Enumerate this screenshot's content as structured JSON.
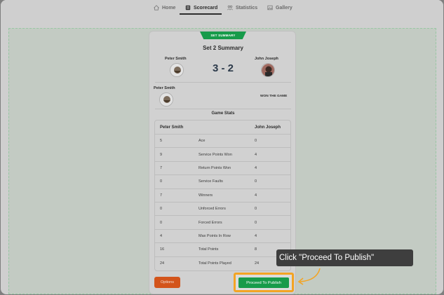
{
  "nav": {
    "items": [
      {
        "label": "Home",
        "icon": "home-icon"
      },
      {
        "label": "Scorecard",
        "icon": "scorecard-icon"
      },
      {
        "label": "Statistics",
        "icon": "statistics-icon"
      },
      {
        "label": "Gallery",
        "icon": "gallery-icon"
      }
    ],
    "active": "Scorecard"
  },
  "card": {
    "ribbon": "SET SUMMARY",
    "title": "Set 2 Summary",
    "player1": "Peter Smith",
    "player2": "John Joseph",
    "score": "3 - 2",
    "winner_name": "Peter Smith",
    "winner_text": "WON THE GAME",
    "stats_title": "Game Stats"
  },
  "table": {
    "header": {
      "left": "Peter Smith",
      "right": "John Joseph"
    },
    "rows": [
      {
        "p1": "5",
        "stat": "Ace",
        "p2": "0"
      },
      {
        "p1": "9",
        "stat": "Service Points Won",
        "p2": "4"
      },
      {
        "p1": "7",
        "stat": "Return Points Won",
        "p2": "4"
      },
      {
        "p1": "0",
        "stat": "Service Faults",
        "p2": "0"
      },
      {
        "p1": "7",
        "stat": "Winners",
        "p2": "4"
      },
      {
        "p1": "0",
        "stat": "Unforced Errors",
        "p2": "0"
      },
      {
        "p1": "0",
        "stat": "Forced Errors",
        "p2": "0"
      },
      {
        "p1": "4",
        "stat": "Max Points In Row",
        "p2": "4"
      },
      {
        "p1": "16",
        "stat": "Total Points",
        "p2": "8"
      },
      {
        "p1": "24",
        "stat": "Total Points Played",
        "p2": "24"
      }
    ]
  },
  "buttons": {
    "options": "Options",
    "publish": "Proceed To Publish"
  },
  "tooltip": "Click \"Proceed To Publish\"",
  "colors": {
    "accent_green": "#179b4a",
    "options_orange": "#d3541b",
    "highlight": "#f3a423"
  }
}
